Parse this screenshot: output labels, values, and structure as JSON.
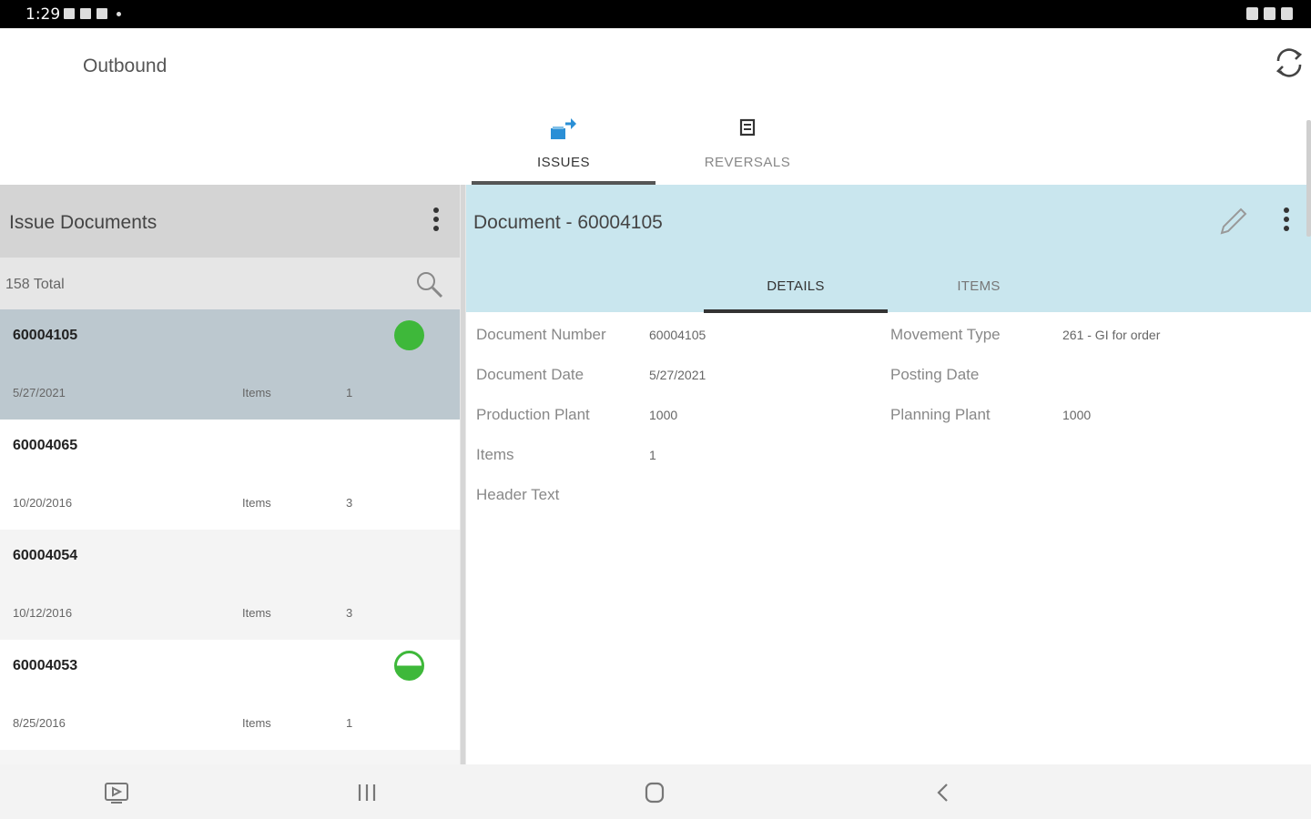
{
  "status_bar": {
    "time": "1:29"
  },
  "app": {
    "title": "Outbound"
  },
  "main_tabs": [
    {
      "label": "ISSUES",
      "icon": "issues-transfer-icon",
      "active": true
    },
    {
      "label": "REVERSALS",
      "icon": "reversals-icon",
      "active": false
    }
  ],
  "list_panel": {
    "title": "Issue Documents",
    "total": "158 Total",
    "items": [
      {
        "number": "60004105",
        "date": "5/27/2021",
        "items_label": "Items",
        "items_count": "1",
        "status": "complete"
      },
      {
        "number": "60004065",
        "date": "10/20/2016",
        "items_label": "Items",
        "items_count": "3",
        "status": ""
      },
      {
        "number": "60004054",
        "date": "10/12/2016",
        "items_label": "Items",
        "items_count": "3",
        "status": ""
      },
      {
        "number": "60004053",
        "date": "8/25/2016",
        "items_label": "Items",
        "items_count": "1",
        "status": "partial"
      }
    ]
  },
  "detail_panel": {
    "title": "Document - 60004105",
    "tabs": [
      {
        "label": "DETAILS",
        "active": true
      },
      {
        "label": "ITEMS",
        "active": false
      }
    ],
    "fields_left": [
      {
        "label": "Document Number",
        "value": "60004105"
      },
      {
        "label": "Document Date",
        "value": "5/27/2021"
      },
      {
        "label": "Production Plant",
        "value": "1000"
      },
      {
        "label": "Items",
        "value": "1"
      },
      {
        "label": "Header Text",
        "value": ""
      }
    ],
    "fields_right": [
      {
        "label": "Movement Type",
        "value": "261 - GI for order"
      },
      {
        "label": "Posting Date",
        "value": ""
      },
      {
        "label": "Planning Plant",
        "value": "1000"
      }
    ]
  },
  "colors": {
    "accent_blue": "#2a8fd6",
    "status_green": "#3eb83a",
    "detail_header_bg": "#c9e6ee",
    "selected_row_bg": "#bcc8cf"
  }
}
